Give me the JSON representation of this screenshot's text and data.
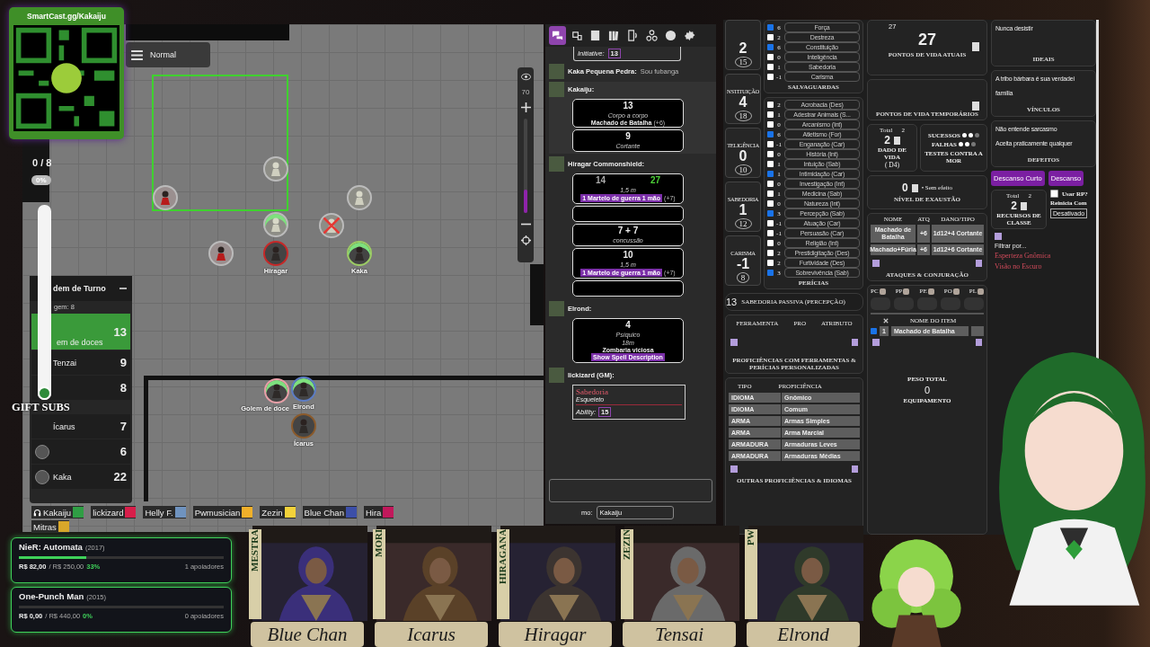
{
  "qr_card": {
    "url": "SmartCast.gg/Kakaiju"
  },
  "map": {
    "mode": "Normal",
    "counter": "0 / 8",
    "percent": "0%",
    "zoom": "70",
    "zoom_slider": {
      "level": 0.25
    },
    "tokens": [
      {
        "kind": "skeleton",
        "defeated": false,
        "hp_bar": false
      },
      {
        "kind": "bandit",
        "defeated": false,
        "hp_bar": false
      },
      {
        "kind": "skeleton",
        "defeated": false,
        "hp_bar": false
      },
      {
        "kind": "skeleton",
        "defeated": false,
        "hp_bar": true
      },
      {
        "kind": "skeleton",
        "defeated": true,
        "hp_bar": false
      },
      {
        "kind": "bandit",
        "defeated": false,
        "hp_bar": false
      },
      {
        "kind": "hero",
        "name": "Hiragar",
        "color": "#c62828",
        "defeated": false,
        "hp_bar": false
      },
      {
        "kind": "hero",
        "name": "Kaka",
        "color": "#9ccc65",
        "defeated": false,
        "hp_bar": true
      },
      {
        "kind": "hero",
        "name": "Golem de doce",
        "color": "#e8a0a8",
        "defeated": false,
        "hp_bar": true
      },
      {
        "kind": "hero",
        "name": "Elrond",
        "color": "#5c7cc4",
        "defeated": false,
        "hp_bar": true
      },
      {
        "kind": "hero",
        "name": "Ícarus",
        "color": "#8a5a2b",
        "defeated": false,
        "hp_bar": false
      }
    ]
  },
  "gift_subs": {
    "label": "GIFT SUBS",
    "level": 0
  },
  "turn_order": {
    "title": "dem de Turno",
    "round": "gem: 8",
    "rows": [
      {
        "name": "em de doces",
        "value": "13",
        "selected": true
      },
      {
        "name": "Tenzai",
        "value": "9",
        "selected": false
      },
      {
        "value": "8",
        "selected": false
      },
      {
        "name": "Ícarus",
        "value": "7",
        "selected": false
      },
      {
        "value": "6",
        "selected": false
      },
      {
        "name": "Kaka",
        "value": "22",
        "selected": false
      }
    ]
  },
  "players": [
    {
      "name": "Kakaiju",
      "color": "#2f9e44",
      "kind": "voice"
    },
    {
      "name": "lickizard",
      "color": "#d81e4a",
      "kind": "plain"
    },
    {
      "name": "Helly F.",
      "color": "#6f93bf",
      "kind": "plain"
    },
    {
      "name": "Pwmusician",
      "color": "#f0b02a",
      "kind": "plain"
    },
    {
      "name": "Zezin",
      "color": "#f3d23a",
      "kind": "plain"
    },
    {
      "name": "Blue Chan",
      "color": "#3c4fa8",
      "kind": "plain"
    },
    {
      "name": "Hira",
      "color": "#c2185b",
      "kind": "plain"
    },
    {
      "name": "Mitras",
      "color": "#d8a72a",
      "kind": "plain"
    }
  ],
  "goals": [
    {
      "title": "NieR: Automata",
      "year": "(2017)",
      "raised": "R$ 82,00",
      "target": "/ R$ 250,00",
      "percent": "33%",
      "supporters": "1 apoiadores",
      "level": 0.33
    },
    {
      "title": "One-Punch Man",
      "year": "(2015)",
      "raised": "R$ 0,00",
      "target": "/ R$ 440,00",
      "percent": "0%",
      "supporters": "0 apoiadores",
      "level": 0
    }
  ],
  "chat": {
    "tabs": [
      {
        "selected": true
      },
      {
        "selected": false
      },
      {
        "selected": false
      },
      {
        "selected": false
      },
      {
        "selected": false
      },
      {
        "selected": false
      },
      {
        "selected": false
      },
      {
        "selected": false
      }
    ],
    "messages": [
      {
        "kind": "initiative",
        "label": "Initiative:",
        "value": "13"
      },
      {
        "kind": "say",
        "speaker": "Kaka Pequena Pedra:",
        "text": "Sou fubanga"
      },
      {
        "kind": "cards",
        "speaker": "Kakaiju:",
        "cards": [
          {
            "kind": "roll",
            "value": "13",
            "italic": "Corpo a corpo",
            "label": "Machado de Batalha",
            "bonus": "(+6)"
          },
          {
            "kind": "roll",
            "value": "9",
            "italic": "Cortante"
          }
        ]
      },
      {
        "kind": "cards",
        "speaker": "Hiragar Commonshield:",
        "cards": [
          {
            "kind": "dual",
            "values": [
              {
                "value": "14",
                "crit": false
              },
              {
                "value": "27",
                "crit": true
              }
            ],
            "italic": "1,5 m",
            "tag": "1 Martelo de guerra 1 mão",
            "bonus": "(+7)"
          },
          {
            "kind": "blank"
          },
          {
            "kind": "roll",
            "value": "7 + 7",
            "italic": "concussão"
          },
          {
            "kind": "roll",
            "value": "10",
            "italic": "1,5 m",
            "tag": "1 Martelo de guerra 1 mão",
            "bonus": "(+7)"
          },
          {
            "kind": "blank"
          }
        ]
      },
      {
        "kind": "cards",
        "speaker": "Elrond:",
        "cards": [
          {
            "kind": "spell",
            "value": "4",
            "italic": "Psíquico",
            "range": "18m",
            "label": "Zombaria viciosa",
            "tag": "Show Spell Description"
          }
        ]
      },
      {
        "kind": "cards",
        "speaker": "lickizard (GM):",
        "cards": [
          {
            "kind": "ability",
            "title": "Sabedoria",
            "subtitle": "Esqueleto",
            "label": "Ability:",
            "value": "15"
          }
        ]
      }
    ],
    "as_label": "mo:",
    "as_value": "Kakaiju"
  },
  "sheet": {
    "stats": [
      {
        "value": "2",
        "score": "15"
      },
      {
        "label": "NSTITUIÇÃO",
        "value": "4",
        "score": "18"
      },
      {
        "label": "TELIGÊNCIA",
        "value": "0",
        "score": "10"
      },
      {
        "label": "SABEDORIA",
        "value": "1",
        "score": "12"
      },
      {
        "label": "CARISMA",
        "value": "-1",
        "score": "8"
      }
    ],
    "saves_title": "SALVAGUARDAS",
    "saves": [
      {
        "value": "6",
        "label": "Força",
        "checked": true
      },
      {
        "value": "2",
        "label": "Destreza",
        "checked": false
      },
      {
        "value": "6",
        "label": "Constituição",
        "checked": true
      },
      {
        "value": "0",
        "label": "Inteligência",
        "checked": false
      },
      {
        "value": "1",
        "label": "Sabedoria",
        "checked": false
      },
      {
        "value": "-1",
        "label": "Carisma",
        "checked": false
      }
    ],
    "skills_title": "PERÍCIAS",
    "skills": [
      {
        "value": "2",
        "label": "Acrobacia (Des)",
        "checked": false
      },
      {
        "value": "1",
        "label": "Adestrar Animais (S...",
        "checked": false
      },
      {
        "value": "0",
        "label": "Arcanismo (Int)",
        "checked": false
      },
      {
        "value": "6",
        "label": "Atletismo (For)",
        "checked": true
      },
      {
        "value": "-1",
        "label": "Enganação (Car)",
        "checked": false
      },
      {
        "value": "0",
        "label": "História (Int)",
        "checked": false
      },
      {
        "value": "1",
        "label": "Intuição (Sab)",
        "checked": false
      },
      {
        "value": "1",
        "label": "Intimidação (Car)",
        "checked": true
      },
      {
        "value": "0",
        "label": "Investigação (Int)",
        "checked": false
      },
      {
        "value": "1",
        "label": "Medicina (Sab)",
        "checked": false
      },
      {
        "value": "0",
        "label": "Natureza (Int)",
        "checked": false
      },
      {
        "value": "3",
        "label": "Percepção (Sab)",
        "checked": true
      },
      {
        "value": "-1",
        "label": "Atuação (Car)",
        "checked": false
      },
      {
        "value": "-1",
        "label": "Persuasão (Car)",
        "checked": false
      },
      {
        "value": "0",
        "label": "Religião (Int)",
        "checked": false
      },
      {
        "value": "2",
        "label": "Prestidigitação (Des)",
        "checked": false
      },
      {
        "value": "2",
        "label": "Furtividade (Des)",
        "checked": false
      },
      {
        "value": "3",
        "label": "Sobrevivência (Sab)",
        "checked": true
      }
    ],
    "passive": {
      "value": "13",
      "label": "SABEDORIA PASSIVA (PERCEPÇÃO)"
    },
    "tools": {
      "columns": [
        "FERRAMENTA",
        "PRO",
        "ATRIBUTO"
      ],
      "title": "PROFICIÊNCIAS COM FERRAMENTAS & PERÍCIAS PERSONALIZADAS"
    },
    "proficiencies": {
      "columns": [
        "TIPO",
        "PROFICIÊNCIA"
      ],
      "rows": [
        [
          "IDIOMA",
          "Gnômico"
        ],
        [
          "IDIOMA",
          "Comum"
        ],
        [
          "ARMA",
          "Armas Simples"
        ],
        [
          "ARMA",
          "Arma Marcial"
        ],
        [
          "ARMADURA",
          "Armaduras Leves"
        ],
        [
          "ARMADURA",
          "Armaduras Médias"
        ]
      ],
      "title": "OUTRAS PROFICIÊNCIAS & IDIOMAS"
    },
    "hp": {
      "max": "27",
      "current": "27",
      "label": "PONTOS DE VIDA ATUAIS",
      "temp_label": "PONTOS DE VIDA TEMPORÁRIOS"
    },
    "hit_dice": {
      "total_label": "Total",
      "total": "2",
      "value": "2",
      "label": "DADO DE VIDA",
      "die": "( D4)"
    },
    "death_saves": {
      "rows": [
        {
          "label": "SUCESSOS",
          "dots": [
            {
              "filled": true
            },
            {
              "filled": true
            },
            {
              "filled": false
            }
          ]
        },
        {
          "label": "FALHAS",
          "dots": [
            {
              "filled": true
            },
            {
              "filled": true
            },
            {
              "filled": false
            }
          ]
        }
      ],
      "label": "TESTES CONTRA A MOR"
    },
    "exhaustion": {
      "value": "0",
      "note": "• Sem efeito",
      "label": "NÍVEL DE EXAUSTÃO"
    },
    "attacks": {
      "columns": [
        "NOME",
        "ATQ",
        "DANO/TIPO"
      ],
      "rows": [
        [
          "Machado de Batalha",
          "+6",
          "1d12+4 Cortante"
        ],
        [
          "Machado+Fúria",
          "+6",
          "1d12+6 Cortante"
        ]
      ],
      "title": "ATAQUES & CONJURAÇÃO"
    },
    "coins": [
      "PC",
      "PP",
      "PE",
      "PO",
      "PL"
    ],
    "items": {
      "column": "NOME DO ITEM",
      "rows": [
        {
          "qty": "1",
          "name": "Machado de Batalha",
          "checked": true
        }
      ],
      "weight_label": "PESO TOTAL",
      "weight": "0",
      "title": "EQUIPAMENTO"
    },
    "ideals": {
      "text": "Nunca desistir",
      "label": "IDEAIS"
    },
    "bonds": {
      "lines": [
        "A tribo bárbara é sua verdadei",
        "família"
      ],
      "label": "VÍNCULOS"
    },
    "flaws": {
      "lines": [
        "Não entende sarcasmo",
        "Aceita praticamente qualquer"
      ],
      "label": "DEFEITOS"
    },
    "rest_buttons": [
      "Descanso Curto",
      "Descanso"
    ],
    "resources": {
      "total_label": "Total",
      "total": "2",
      "value": "2",
      "label": "RECURSOS DE CLASSE",
      "use_label": "Usar RP?",
      "use_checked": false,
      "reset_label": "Reinicia Com",
      "reset_value": "Desativado"
    },
    "traits": {
      "filter": "Filtrar por...",
      "items": [
        {
          "name": "Esperteza Gnômica"
        },
        {
          "name": "Visão no Escuro"
        }
      ]
    }
  },
  "portraits": [
    {
      "tag": "MESTRA",
      "name": "Blue Chan"
    },
    {
      "tag": "MORI",
      "name": "Icarus"
    },
    {
      "tag": "HIRAGANA",
      "name": "Hiragar"
    },
    {
      "tag": "ZEZIN",
      "name": "Tensai"
    },
    {
      "tag": "PW",
      "name": "Elrond"
    }
  ]
}
